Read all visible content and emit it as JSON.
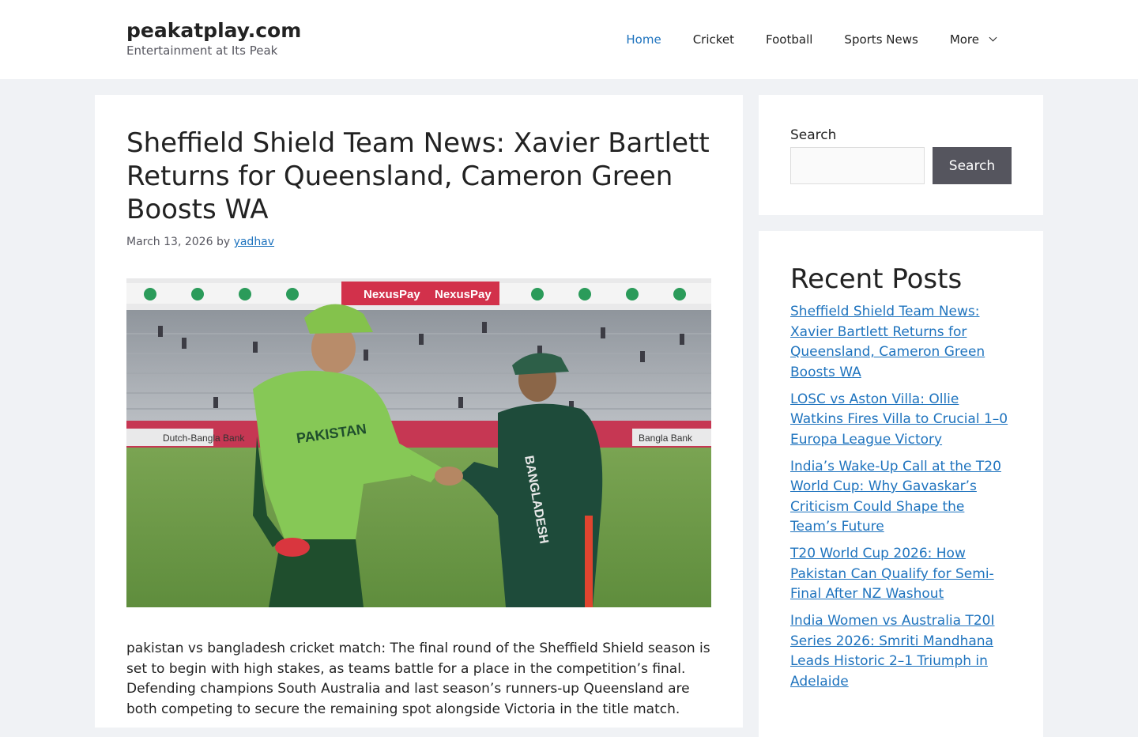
{
  "site": {
    "title": "peakatplay.com",
    "tagline": "Entertainment at Its Peak"
  },
  "nav": {
    "items": [
      {
        "label": "Home",
        "active": true
      },
      {
        "label": "Cricket"
      },
      {
        "label": "Football"
      },
      {
        "label": "Sports News"
      },
      {
        "label": "More"
      }
    ]
  },
  "article": {
    "title": "Sheffield Shield Team News: Xavier Bartlett Returns for Queensland, Cameron Green Boosts WA",
    "date": "March 13, 2026",
    "by": "by",
    "author": "yadhav",
    "image_scene": {
      "billboard_text": [
        "NexusPay",
        "NexusPay",
        "Dutch-Bangla Bank",
        "Bangla Bank"
      ],
      "left_jersey_text": "PAKISTAN",
      "right_jersey_text": "BANGLADESH"
    },
    "content": "pakistan vs bangladesh cricket match: The final round of the Sheffield Shield season is set to begin with high stakes, as teams battle for a place in the competition’s final. Defending champions South Australia and last season’s runners-up Queensland are both competing to secure the remaining spot alongside Victoria in the title match."
  },
  "sidebar": {
    "search": {
      "label": "Search",
      "placeholder": "",
      "button": "Search"
    },
    "recent": {
      "title": "Recent Posts",
      "posts": [
        "Sheffield Shield Team News: Xavier Bartlett Returns for Queensland, Cameron Green Boosts WA",
        "LOSC vs Aston Villa: Ollie Watkins Fires Villa to Crucial 1–0 Europa League Victory",
        "India’s Wake-Up Call at the T20 World Cup: Why Gavaskar’s Criticism Could Shape the Team’s Future",
        "T20 World Cup 2026: How Pakistan Can Qualify for Semi-Final After NZ Washout",
        "India Women vs Australia T20I Series 2026: Smriti Mandhana Leads Historic 2–1 Triumph in Adelaide"
      ]
    }
  },
  "colors": {
    "link": "#1e73be",
    "page_bg": "#f0f2f5",
    "button_bg": "#55555e"
  }
}
